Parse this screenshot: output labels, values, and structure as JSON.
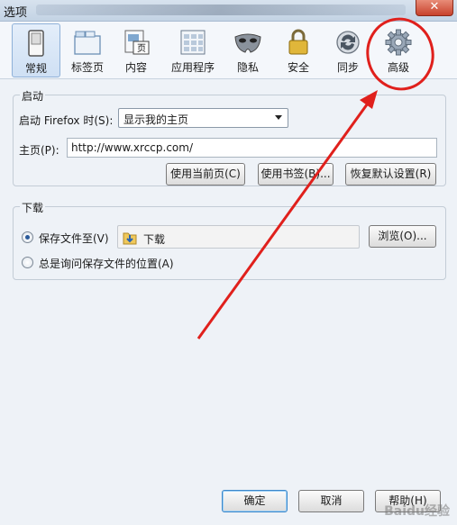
{
  "window": {
    "title": "选项",
    "close_label": "✕"
  },
  "toolbar": {
    "items": [
      {
        "label": "常规",
        "icon": "switch-icon"
      },
      {
        "label": "标签页",
        "icon": "tabs-icon"
      },
      {
        "label": "内容",
        "icon": "page-icon"
      },
      {
        "label": "应用程序",
        "icon": "applications-icon"
      },
      {
        "label": "隐私",
        "icon": "mask-icon"
      },
      {
        "label": "安全",
        "icon": "padlock-icon"
      },
      {
        "label": "同步",
        "icon": "sync-icon"
      },
      {
        "label": "高级",
        "icon": "gear-icon"
      }
    ],
    "active": "常规"
  },
  "startup": {
    "group_title": "启动",
    "when_label": "启动 Firefox 时(S):",
    "when_value": "显示我的主页",
    "homepage_label": "主页(P):",
    "homepage_value": "http://www.xrccp.com/",
    "use_current_label": "使用当前页(C)",
    "use_bookmark_label": "使用书签(B)...",
    "restore_default_label": "恢复默认设置(R)"
  },
  "downloads": {
    "group_title": "下载",
    "save_to_label": "保存文件至(V)",
    "save_to_checked": true,
    "folder_name": "下载",
    "browse_label": "浏览(O)...",
    "ask_label": "总是询问保存文件的位置(A)",
    "ask_checked": false
  },
  "footer": {
    "ok_label": "确定",
    "cancel_label": "取消",
    "help_label": "帮助(H)"
  },
  "annotation": {
    "color": "#e0201c"
  },
  "watermark": "Baidu经验",
  "colors": {
    "accent": "#3d87c9",
    "annotation_red": "#e0201c"
  }
}
